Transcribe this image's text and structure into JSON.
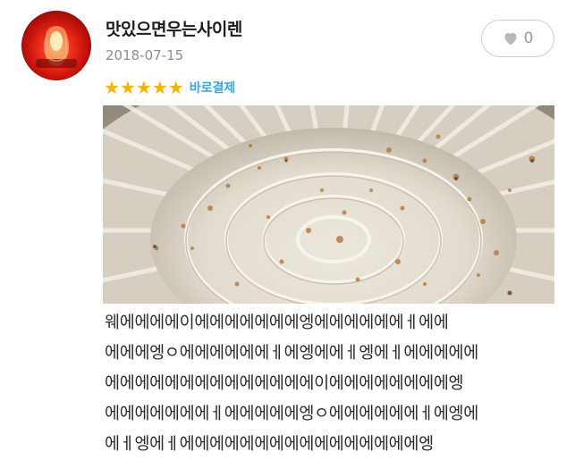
{
  "review": {
    "username": "맛있으면우는사이렌",
    "date": "2018-07-15",
    "likes": "0",
    "rating": 5,
    "badge": "바로결제",
    "lines": [
      "웨에에에에이에에에에에에에엥에에에에에에ㅔ에에",
      "에에에엥ㅇ에에에에에에ㅔ에엥에에ㅔ엥에ㅔ에에에에에",
      "에에에에에에에에에에에에에에이에에에에에에에에엥",
      "에에에에에에에ㅔ에에에에에엥ㅇ에에에에에에ㅔ에엥에",
      "에ㅔ엥에ㅔ에에에에에에에에에에에에에에에에엥"
    ]
  },
  "icons": {
    "avatar": "siren-icon",
    "like": "heart-icon",
    "star": "star-icon"
  },
  "colors": {
    "star": "#f4b400",
    "badge": "#3aa7d8",
    "date": "#8e8e8e"
  }
}
